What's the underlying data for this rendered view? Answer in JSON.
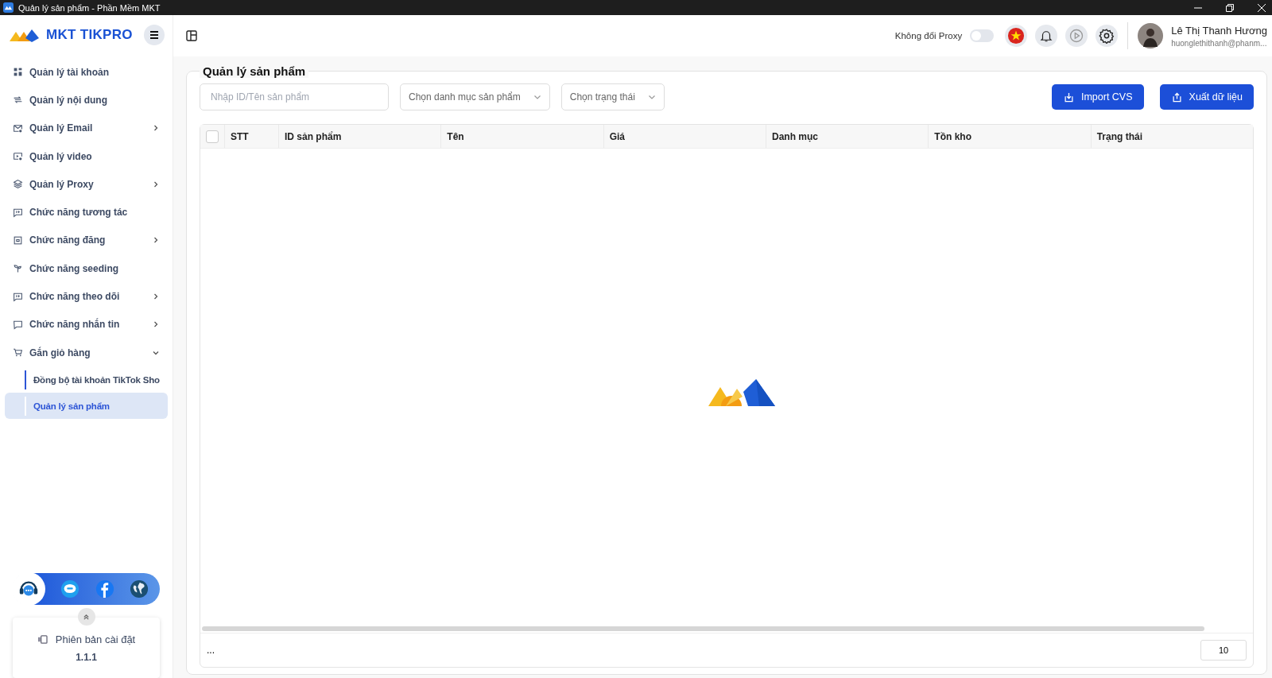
{
  "window": {
    "title": "Quản lý sản phẩm - Phần Mềm MKT"
  },
  "brand": "MKT TIKPRO",
  "sidebar": {
    "items": [
      {
        "label": "Quản lý tài khoản",
        "kind": "link",
        "selected": false
      },
      {
        "label": "Quản lý nội dung",
        "kind": "link",
        "selected": false
      },
      {
        "label": "Quản lý Email",
        "kind": "group",
        "expanded": false,
        "selected": false
      },
      {
        "label": "Quản lý video",
        "kind": "link",
        "selected": false
      },
      {
        "label": "Quản lý Proxy",
        "kind": "group",
        "expanded": false,
        "selected": false
      },
      {
        "label": "Chức năng tương tác",
        "kind": "link",
        "selected": false
      },
      {
        "label": "Chức năng đăng",
        "kind": "group",
        "expanded": false,
        "selected": false
      },
      {
        "label": "Chức năng seeding",
        "kind": "link",
        "selected": false
      },
      {
        "label": "Chức năng theo dõi",
        "kind": "group",
        "expanded": false,
        "selected": false
      },
      {
        "label": "Chức năng nhắn tin",
        "kind": "group",
        "expanded": false,
        "selected": false
      },
      {
        "label": "Gắn giỏ hàng",
        "kind": "group",
        "expanded": true,
        "selected": false,
        "children": [
          {
            "label": "Đồng bộ tài khoản TikTok Sho",
            "selected": false
          },
          {
            "label": "Quản lý sản phẩm",
            "selected": true
          }
        ]
      }
    ]
  },
  "version": {
    "label": "Phiên bản cài đặt",
    "value": "1.1.1"
  },
  "topbar": {
    "proxy": {
      "label": "Không đổi Proxy",
      "on": false
    },
    "user": {
      "name": "Lê Thị Thanh Hương",
      "email": "huonglethithanh@phanm..."
    }
  },
  "page": {
    "title": "Quản lý sản phẩm",
    "search": {
      "placeholder": "Nhập ID/Tên sản phẩm"
    },
    "filters": [
      {
        "placeholder": "Chọn danh mục sản phẩm"
      },
      {
        "placeholder": "Chọn trạng thái"
      }
    ],
    "buttons": [
      {
        "label": "Import CVS",
        "kind": "import"
      },
      {
        "label": "Xuất dữ liệu",
        "kind": "export"
      }
    ],
    "table": {
      "select_all": {
        "checked": false
      },
      "columns": [
        "STT",
        "ID sản phẩm",
        "Tên",
        "Giá",
        "Danh mục",
        "Tồn kho",
        "Trạng thái"
      ]
    },
    "footer": {
      "text": "...",
      "page_size": "10"
    }
  }
}
